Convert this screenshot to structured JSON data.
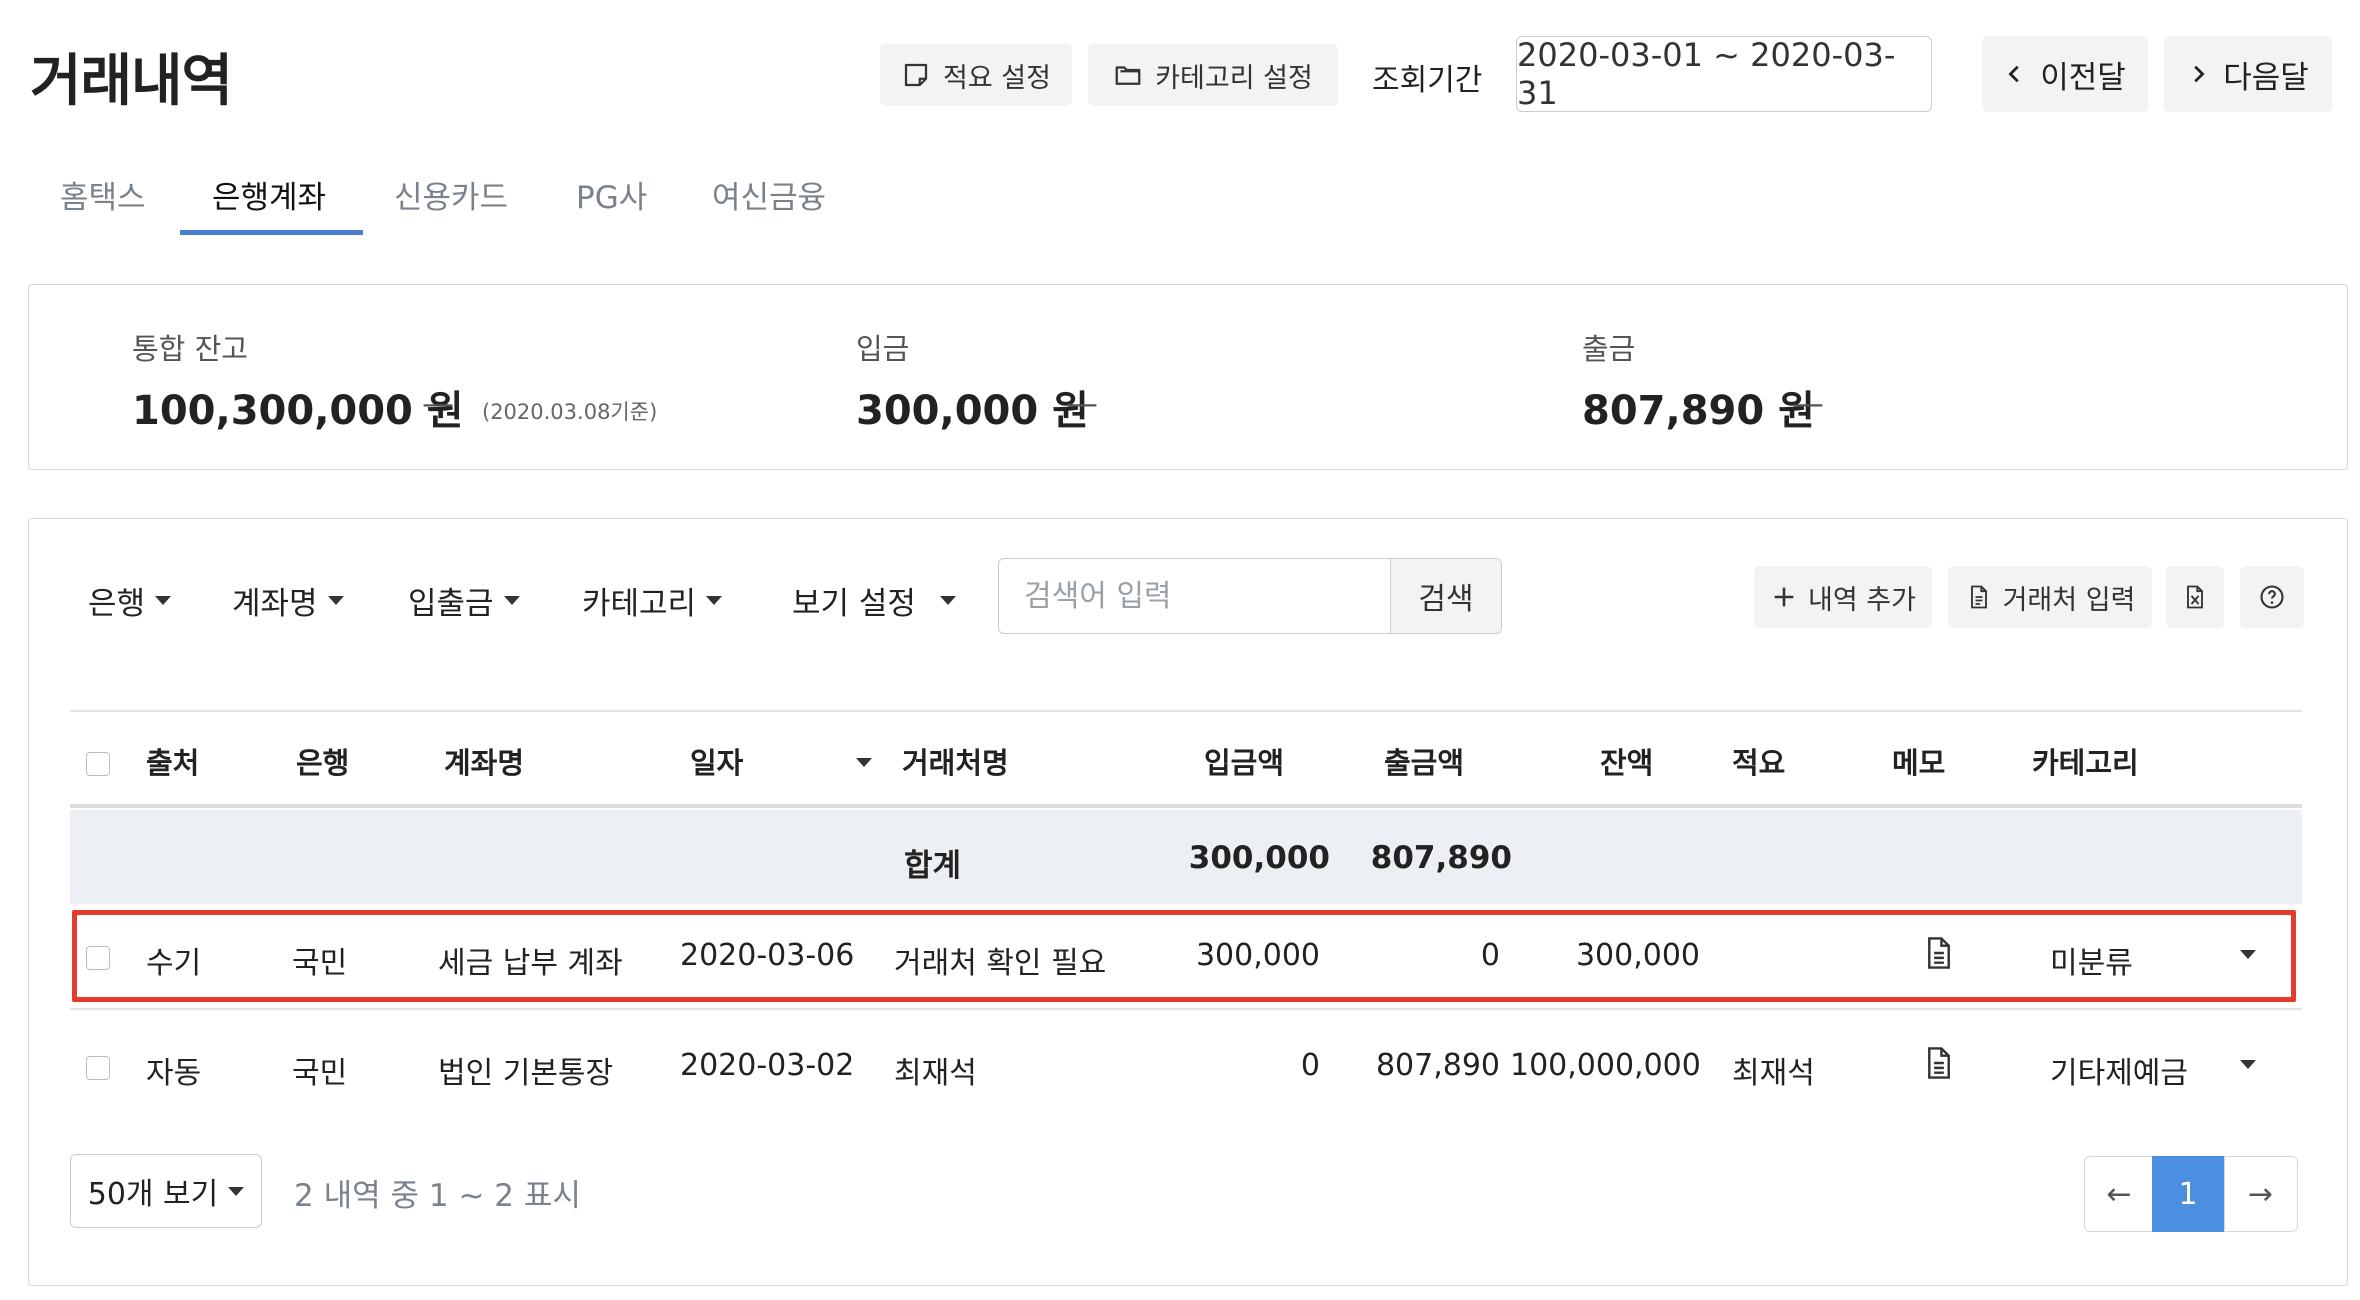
{
  "header": {
    "title": "거래내역",
    "memo_settings_label": "적요 설정",
    "category_settings_label": "카테고리 설정",
    "period_label": "조회기간",
    "date_range": "2020-03-01 ~ 2020-03-31",
    "prev_month_label": "이전달",
    "next_month_label": "다음달"
  },
  "tabs": [
    {
      "label": "홈택스",
      "active": false
    },
    {
      "label": "은행계좌",
      "active": true
    },
    {
      "label": "신용카드",
      "active": false
    },
    {
      "label": "PG사",
      "active": false
    },
    {
      "label": "여신금융",
      "active": false
    }
  ],
  "summary": {
    "balance_label": "통합 잔고",
    "balance_value": "100,300,000 원",
    "balance_dash": "—",
    "balance_note": "(2020.03.08기준)",
    "deposit_label": "입금",
    "deposit_value": "300,000 원",
    "deposit_dash": "—",
    "withdraw_label": "출금",
    "withdraw_value": "807,890 원",
    "withdraw_dash": "—"
  },
  "filters": [
    "은행",
    "계좌명",
    "입출금",
    "카테고리",
    "보기 설정"
  ],
  "search": {
    "placeholder": "검색어 입력",
    "button_label": "검색"
  },
  "toolbar": {
    "add_entry_label": "내역 추가",
    "counterparty_label": "거래처 입력",
    "excel_icon": "excel-file-icon",
    "help_icon": "help-circle-icon"
  },
  "table": {
    "columns": [
      "출처",
      "은행",
      "계좌명",
      "일자",
      "거래처명",
      "입금액",
      "출금액",
      "잔액",
      "적요",
      "메모",
      "카테고리"
    ],
    "total": {
      "label": "합계",
      "deposit": "300,000",
      "withdraw": "807,890"
    },
    "rows": [
      {
        "source": "수기",
        "bank": "국민",
        "account": "세금 납부 계좌",
        "date": "2020-03-06",
        "counterparty": "거래처 확인 필요",
        "deposit": "300,000",
        "withdraw": "0",
        "balance": "300,000",
        "note": "",
        "category": "미분류",
        "highlighted": true
      },
      {
        "source": "자동",
        "bank": "국민",
        "account": "법인 기본통장",
        "date": "2020-03-02",
        "counterparty": "최재석",
        "deposit": "0",
        "withdraw": "807,890",
        "balance": "100,000,000",
        "note": "최재석",
        "category": "기타제예금",
        "highlighted": false
      }
    ]
  },
  "footer": {
    "per_page_label": "50개 보기",
    "count_text": "2 내역 중 1 ~ 2 표시",
    "prev_arrow": "←",
    "current_page": "1",
    "next_arrow": "→"
  },
  "colors": {
    "accent": "#4a7fd0",
    "highlight": "#e53b2c",
    "pager_active": "#4a8fe0",
    "total_row_bg": "#eceff3"
  }
}
